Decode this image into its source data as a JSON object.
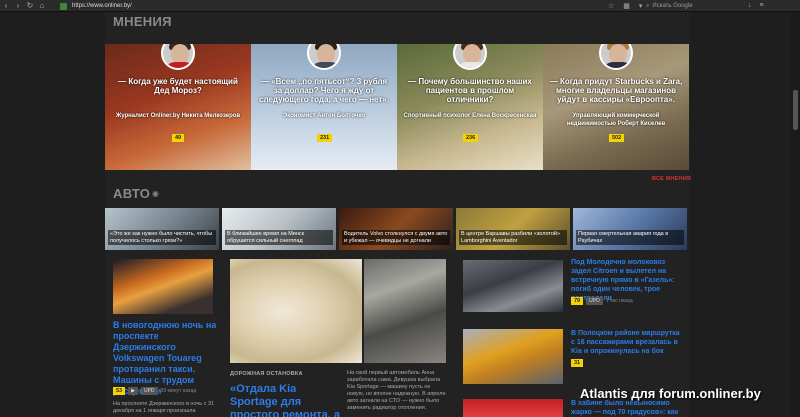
{
  "browser": {
    "url": "https://www.onliner.by/",
    "search_placeholder": "Искать Google"
  },
  "opinions": {
    "title": "МНЕНИЯ",
    "all_link": "ВСЕ МНЕНИЯ",
    "cards": [
      {
        "quote": "— Когда уже будет настоящий Дед Мороз?",
        "author": "Журналист Onliner.by Никита Мелкозеров",
        "count": "49"
      },
      {
        "quote": "— «Всем „по пятьсот“? 3 рубля за доллар? Чего я жду от следующего года, а чего — нет».",
        "author": "Экономист Антон Болточко",
        "count": "231"
      },
      {
        "quote": "— Почему большинство наших пациентов в прошлом отличники?",
        "author": "Спортивный психолог Елена Воскресенская",
        "count": "236"
      },
      {
        "quote": "— Когда придут Starbucks и Zara, многие владельцы магазинов уйдут в кассиры «Евроопта».",
        "author": "Управляющий коммерческой недвижимостью Роберт Киселев",
        "count": "502"
      }
    ]
  },
  "auto": {
    "title": "АВТО",
    "strip": [
      "«Это же как нужно было чистить, чтобы получилось столько грязи?»",
      "В ближайшее время на Минск обрушится сильный снегопад",
      "Водитель Volvo столкнулся с двумя авто и убежал — очевидцы не догнали",
      "В центре Варшавы разбили «золотой» Lamborghini Aventador",
      "Первая смертельная авария года в Раубичах"
    ],
    "left_news": {
      "title": "В новогоднюю ночь на проспекте Дзержинского Volkswagen Touareg протаранил такси. Машины с трудом расцепили",
      "count": "53",
      "tag": "UPD",
      "time": "39 минут назад",
      "excerpt": "На проспекте Дзержинского в ночь с 31 декабря на 1 января произошла"
    },
    "center_news": {
      "kicker": "ДОРОЖНАЯ ОСТАНОВКА",
      "title": "«Отдала Kia Sportage для простого ремонта, а машину разбили о",
      "excerpt": "На свой первый автомобиль Анна заработала сама. Девушка выбрала Kia Sportage — машину пусть не новую, но вполне надежную. В апреле авто загнали на СТО — нужно было заменить радиатор отопления."
    },
    "right_news": [
      {
        "title": "Под Молодечно молоковоз задел Citroen и вылетел на встречную прямо в «Газель»: погиб один человек, трое пострадали",
        "count": "79",
        "tag": "UPD",
        "time": "1 час назад"
      },
      {
        "title": "В Полоцком районе маршрутка с 16 пассажирами врезалась в Kia и опрокинулась на бок",
        "count": "31"
      },
      {
        "title": "В хабине было невыносимо жарко — под 70 градусов»: как для",
        "count": ""
      }
    ]
  },
  "watermark": "Atlantis для forum.onliner.by"
}
